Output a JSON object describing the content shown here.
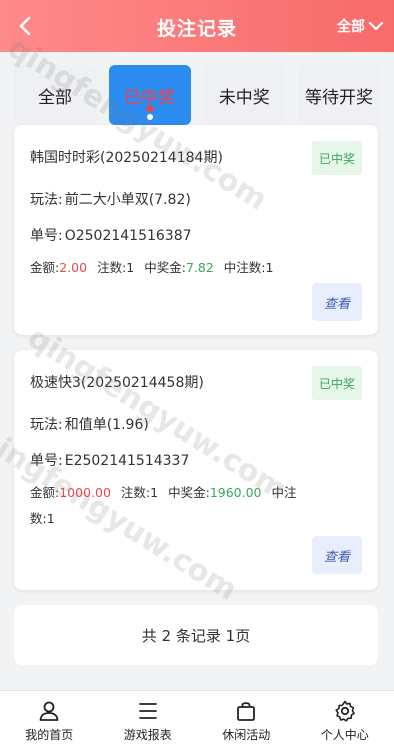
{
  "header": {
    "title": "投注记录",
    "filter_label": "全部"
  },
  "tabs": [
    {
      "label": "全部",
      "active": false
    },
    {
      "label": "已中奖",
      "active": true
    },
    {
      "label": "未中奖",
      "active": false
    },
    {
      "label": "等待开奖",
      "active": false
    }
  ],
  "records": [
    {
      "game": "韩国时时彩(20250214184期)",
      "status": "已中奖",
      "play_key": "玩法:",
      "play_value": "前二大小单双(7.82)",
      "order_key": "单号:",
      "order_value": "O2502141516387",
      "amount_key": "金额:",
      "amount_value": "2.00",
      "bets_key": "注数:",
      "bets_value": "1",
      "win_key": "中奖金:",
      "win_value": "7.82",
      "winbets_key": "中注数:",
      "winbets_value": "1",
      "view_label": "查看"
    },
    {
      "game": "极速快3(20250214458期)",
      "status": "已中奖",
      "play_key": "玩法:",
      "play_value": "和值单(1.96)",
      "order_key": "单号:",
      "order_value": "E2502141514337",
      "amount_key": "金额:",
      "amount_value": "1000.00",
      "bets_key": "注数:",
      "bets_value": "1",
      "win_key": "中奖金:",
      "win_value": "1960.00",
      "winbets_key": "中注",
      "winbets_key2": "数:",
      "winbets_value": "1",
      "view_label": "查看"
    }
  ],
  "summary": "共 2 条记录 1页",
  "nav": [
    {
      "label": "我的首页",
      "icon": "user-icon"
    },
    {
      "label": "游戏报表",
      "icon": "list-icon"
    },
    {
      "label": "休闲活动",
      "icon": "bag-icon"
    },
    {
      "label": "个人中心",
      "icon": "gear-icon"
    }
  ],
  "watermark": "qingfengyuw.com",
  "colors": {
    "header_start": "#ff8a8a",
    "header_end": "#f76b6b",
    "active_tab": "#2d8cf0",
    "win_green": "#3aa85a",
    "amount_red": "#e94b4b"
  }
}
